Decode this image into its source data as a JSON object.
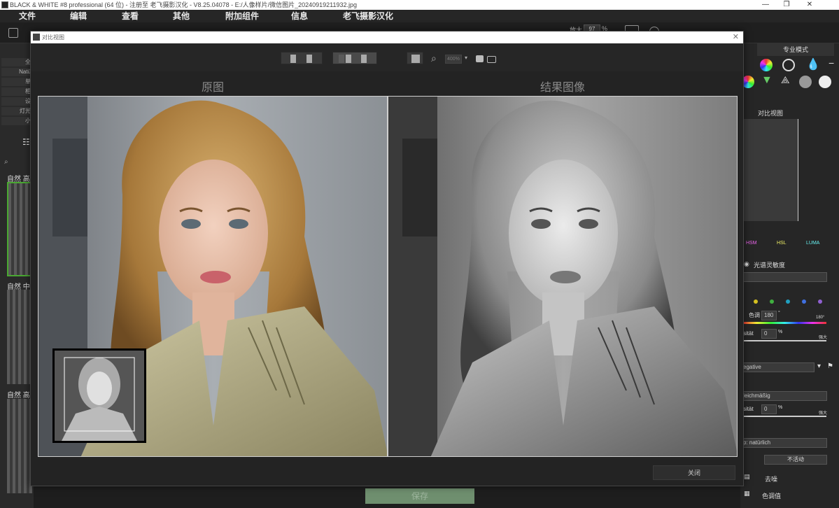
{
  "window": {
    "title": "BLACK & WHITE #8 professional (64 位) - 注册至 老飞摄影汉化 - V8.25.04078 - E:/人像样片/微信图片_20240919211932.jpg",
    "minimize": "—",
    "maximize": "❐",
    "close": "✕"
  },
  "menu": [
    "文件",
    "编辑",
    "查看",
    "其他",
    "附加组件",
    "信息",
    "老飞摄影汉化"
  ],
  "toolbar": {
    "zoom_label": "放大",
    "zoom_value": "97",
    "zoom_unit": "%"
  },
  "left_panel": {
    "rows": [
      "全",
      "Natü",
      "单",
      "相",
      "设",
      "灯光",
      "小"
    ],
    "presets": [
      "自然 高",
      "自然 中",
      "自然 高"
    ]
  },
  "right_panel": {
    "tab": "专业模式",
    "compare_label": "对比视图",
    "modes": [
      "HSM",
      "HSL",
      "LUMA"
    ],
    "spectral_label": "光谱灵敏度",
    "hue_label": "色调",
    "hue_value": "180",
    "hue_degree": "°",
    "hue_max": "180°",
    "intensity_label": "sität",
    "intensity_value": "0",
    "intensity_unit": "%",
    "intensity_max": "强大",
    "dd_negative": "egative",
    "dd_gleich": "leichmäßig",
    "intensity2_label": "sität",
    "intensity2_value": "0",
    "intensity2_unit": "%",
    "intensity2_max": "强大",
    "dd_natur": "p: natürlich",
    "inactive": "不活动",
    "denoise": "去噪",
    "tone": "色调值"
  },
  "bottom": {
    "save": "保存"
  },
  "dialog": {
    "title": "对比视图",
    "close_x": "✕",
    "zoom_value": "400%",
    "left_label": "原图",
    "right_label": "结果图像",
    "close_button": "关闭"
  },
  "colors": {
    "accent_green": "#6f8f6f",
    "dot_colors": [
      "#d4c020",
      "#40b040",
      "#20a0c0",
      "#4070e0",
      "#9060d0"
    ]
  }
}
